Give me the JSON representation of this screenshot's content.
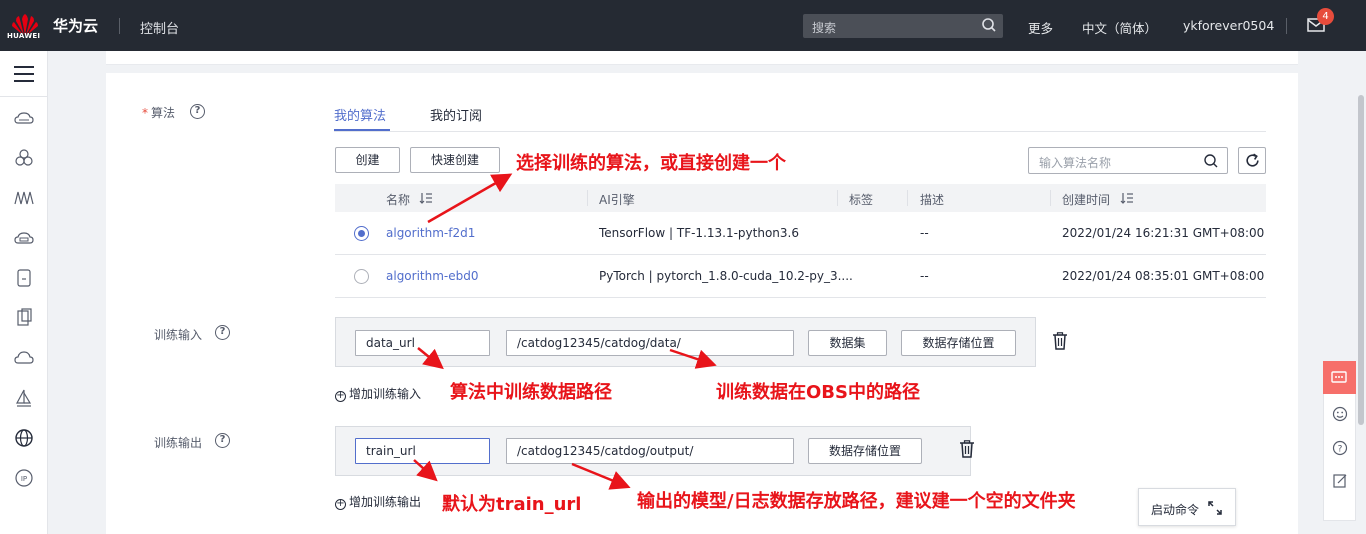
{
  "header": {
    "logo_text": "HUAWEI",
    "brand": "华为云",
    "console": "控制台",
    "search_placeholder": "搜索",
    "more": "更多",
    "language": "中文（简体）",
    "username": "ykforever0504",
    "mail_badge": "4"
  },
  "sidebar": {
    "icons": [
      "cloud-storage-icon",
      "cloud-cluster-icon",
      "monitor-wave-icon",
      "cloud-db-icon",
      "device-icon",
      "document-icon",
      "cloud-outline-icon",
      "sailboat-icon",
      "globe-icon",
      "ip-icon"
    ]
  },
  "form": {
    "algorithm_label": "算法",
    "required_mark": "*",
    "train_input_label": "训练输入",
    "train_output_label": "训练输出",
    "help_glyph": "?"
  },
  "tabs": [
    "我的算法",
    "我的订阅"
  ],
  "toolbar": {
    "create_label": "创建",
    "quick_create_label": "快速创建",
    "search_placeholder": "输入算法名称"
  },
  "table": {
    "headers": [
      "名称",
      "AI引擎",
      "标签",
      "描述",
      "创建时间"
    ],
    "rows": [
      {
        "name": "algorithm-f2d1",
        "engine": "TensorFlow | TF-1.13.1-python3.6",
        "tag": "",
        "desc": "--",
        "created": "2022/01/24 16:21:31 GMT+08:00",
        "selected": true
      },
      {
        "name": "algorithm-ebd0",
        "engine": "PyTorch | pytorch_1.8.0-cuda_10.2-py_3....",
        "tag": "",
        "desc": "--",
        "created": "2022/01/24 08:35:01 GMT+08:00",
        "selected": false
      }
    ]
  },
  "train_input": {
    "name_value": "data_url",
    "path_value": "/catdog12345/catdog/data/",
    "dataset_button": "数据集",
    "storage_button": "数据存储位置",
    "add_label": "增加训练输入"
  },
  "train_output": {
    "name_value": "train_url",
    "path_value": "/catdog12345/catdog/output/",
    "storage_button": "数据存储位置",
    "add_label": "增加训练输出"
  },
  "annotations": {
    "a1": "选择训练的算法，或直接创建一个",
    "a2": "算法中训练数据路径",
    "a3": "训练数据在OBS中的路径",
    "a4": "默认为train_url",
    "a5": "输出的模型/日志数据存放路径，建议建一个空的文件夹",
    "color": "#e8141a"
  },
  "floating": {
    "launch_label": "启动命令",
    "accent": "#f66f6a"
  },
  "colors": {
    "topbar": "#252a33",
    "accent_blue": "#526ecc",
    "annotation_red": "#e8141a"
  }
}
